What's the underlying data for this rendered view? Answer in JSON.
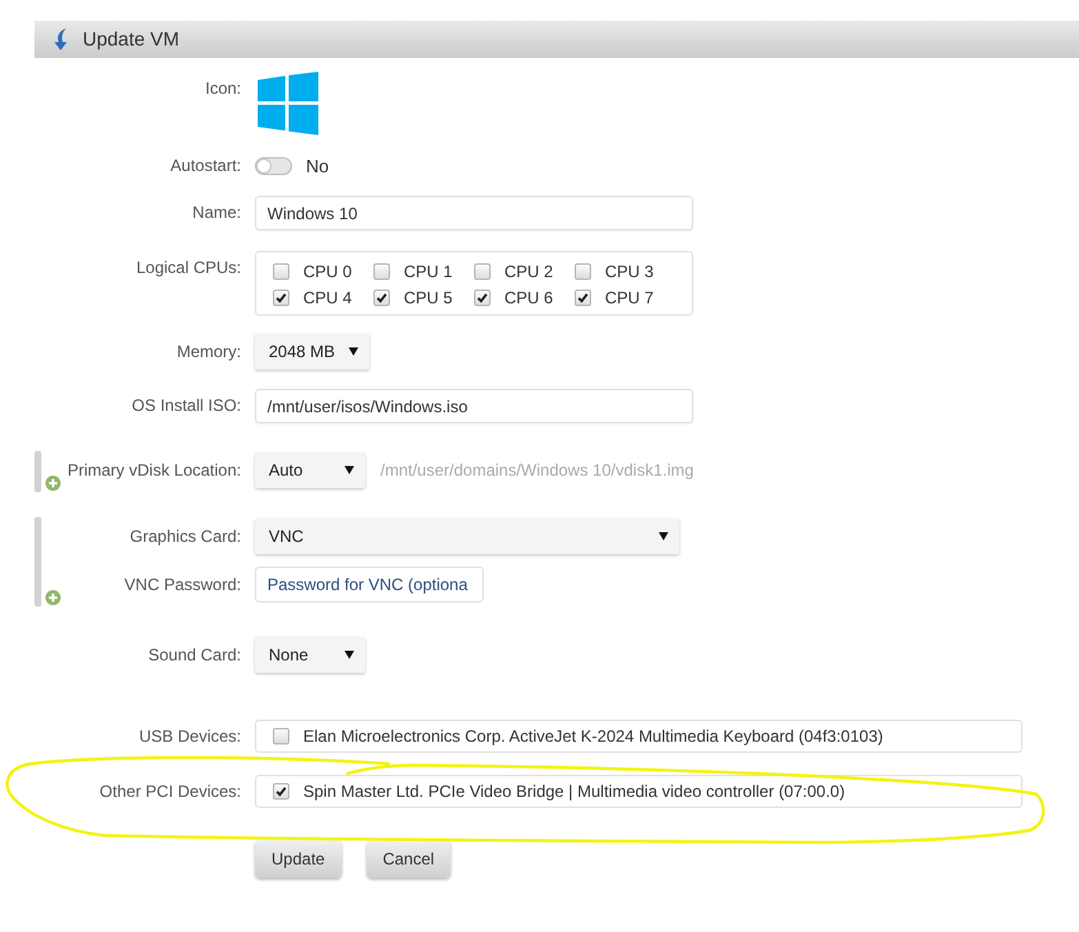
{
  "window": {
    "title": "Update VM"
  },
  "form": {
    "sections": [
      {
        "expandable": false,
        "fields": [
          {
            "kind": "icon",
            "label": "Icon:"
          },
          {
            "kind": "toggle",
            "label": "Autostart:",
            "on": false,
            "value": "No"
          },
          {
            "kind": "text",
            "label": "Name:",
            "value": "Windows 10"
          },
          {
            "kind": "checkgrid",
            "label": "Logical CPUs:",
            "options": [
              {
                "label": "CPU 0",
                "checked": false
              },
              {
                "label": "CPU 1",
                "checked": false
              },
              {
                "label": "CPU 2",
                "checked": false
              },
              {
                "label": "CPU 3",
                "checked": false
              },
              {
                "label": "CPU 4",
                "checked": true
              },
              {
                "label": "CPU 5",
                "checked": true
              },
              {
                "label": "CPU 6",
                "checked": true
              },
              {
                "label": "CPU 7",
                "checked": true
              }
            ]
          },
          {
            "kind": "select",
            "label": "Memory:",
            "value": "2048 MB"
          },
          {
            "kind": "text",
            "label": "OS Install ISO:",
            "value": "/mnt/user/isos/Windows.iso"
          }
        ]
      },
      {
        "expandable": true,
        "fields": [
          {
            "kind": "select",
            "label": "Primary vDisk Location:",
            "value": "Auto",
            "path": "/mnt/user/domains/Windows 10/vdisk1.img"
          }
        ]
      },
      {
        "expandable": true,
        "fields": [
          {
            "kind": "select",
            "label": "Graphics Card:",
            "value": "VNC"
          },
          {
            "kind": "password",
            "label": "VNC Password:",
            "placeholder": "Password for VNC (optiona"
          }
        ]
      },
      {
        "expandable": false,
        "fields": [
          {
            "kind": "select",
            "label": "Sound Card:",
            "value": "None"
          }
        ]
      },
      {
        "expandable": false,
        "fields": [
          {
            "kind": "devices",
            "label": "USB Devices:",
            "annotated": false,
            "devices": [
              {
                "label": "Elan Microelectronics Corp. ActiveJet K-2024 Multimedia Keyboard (04f3:0103)",
                "checked": false
              }
            ]
          },
          {
            "kind": "devices",
            "label": "Other PCI Devices:",
            "annotated": true,
            "devices": [
              {
                "label": "Spin Master Ltd. PCIe Video Bridge | Multimedia video controller (07:00.0)",
                "checked": true
              }
            ]
          }
        ]
      }
    ]
  },
  "buttons": [
    "Update",
    "Cancel"
  ]
}
